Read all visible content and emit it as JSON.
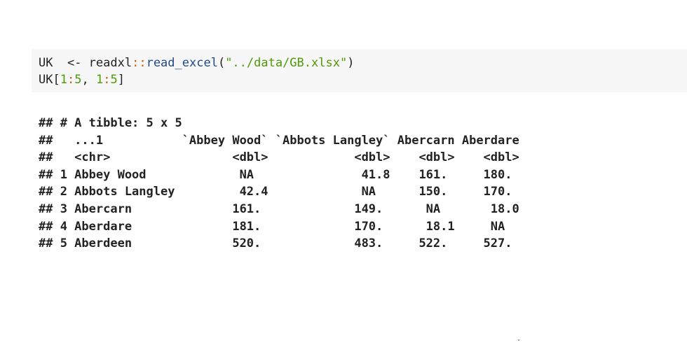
{
  "code": {
    "line1": {
      "var": "UK",
      "assign": "  <- ",
      "pkg": "readxl",
      "sep": "::",
      "fn": "read_excel",
      "open": "(",
      "arg": "\"../data/GB.xlsx\"",
      "close": ")"
    },
    "line2": {
      "var": "UK",
      "open": "[",
      "a1": "1",
      "c1": ":",
      "a2": "5",
      "comma": ", ",
      "b1": "1",
      "c2": ":",
      "b2": "5",
      "close": "]"
    }
  },
  "output": {
    "lines": [
      "## # A tibble: 5 x 5",
      "##   ...1           `Abbey Wood` `Abbots Langley` Abercarn Aberdare",
      "##   <chr>                 <dbl>            <dbl>    <dbl>    <dbl>",
      "## 1 Abbey Wood             NA               41.8    161.     180. ",
      "## 2 Abbots Langley         42.4             NA      150.     170. ",
      "## 3 Abercarn              161.             149.      NA       18.0",
      "## 4 Aberdare              181.             170.      18.1     NA  ",
      "## 5 Aberdeen              520.             483.     522.     527. "
    ]
  }
}
